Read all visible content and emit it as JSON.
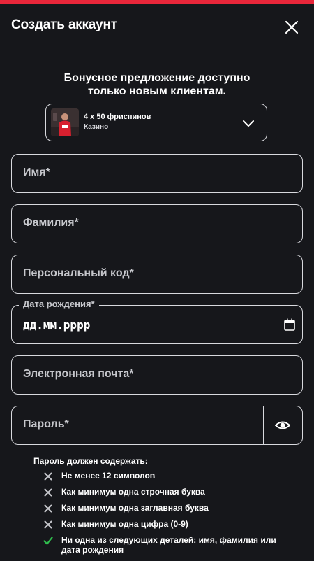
{
  "header": {
    "title": "Создать аккаунт"
  },
  "bonus": {
    "line1": "Бонусное предложение доступно",
    "line2": "только новым клиентам.",
    "offer_name": "4 x 50 фриспинов",
    "offer_category": "Казино"
  },
  "form": {
    "first_name_label": "Имя",
    "last_name_label": "Фамилия",
    "personal_code_label": "Персональный код",
    "birth_date_label": "Дата рождения",
    "birth_date_placeholder": "дд.мм.pppp",
    "email_label": "Электронная почта",
    "password_label": "Пароль",
    "required_mark": "*"
  },
  "password_rules": {
    "heading": "Пароль должен содержать:",
    "items": [
      {
        "text": "Не менее 12 символов",
        "status": "fail"
      },
      {
        "text": "Как минимум одна строчная буква",
        "status": "fail"
      },
      {
        "text": "Как минимум одна заглавная буква",
        "status": "fail"
      },
      {
        "text": "Как минимум одна цифра (0-9)",
        "status": "fail"
      },
      {
        "text": "Ни одна из следующих деталей: имя, фамилия или дата рождения",
        "status": "pass"
      }
    ]
  },
  "colors": {
    "background": "#16171b",
    "accent_red": "#e8263a",
    "pass_green": "#2fbf4e",
    "border": "#d8d9de"
  },
  "icons": [
    "close-icon",
    "chevron-down-icon",
    "calendar-icon",
    "eye-icon",
    "cross-icon",
    "check-icon"
  ]
}
